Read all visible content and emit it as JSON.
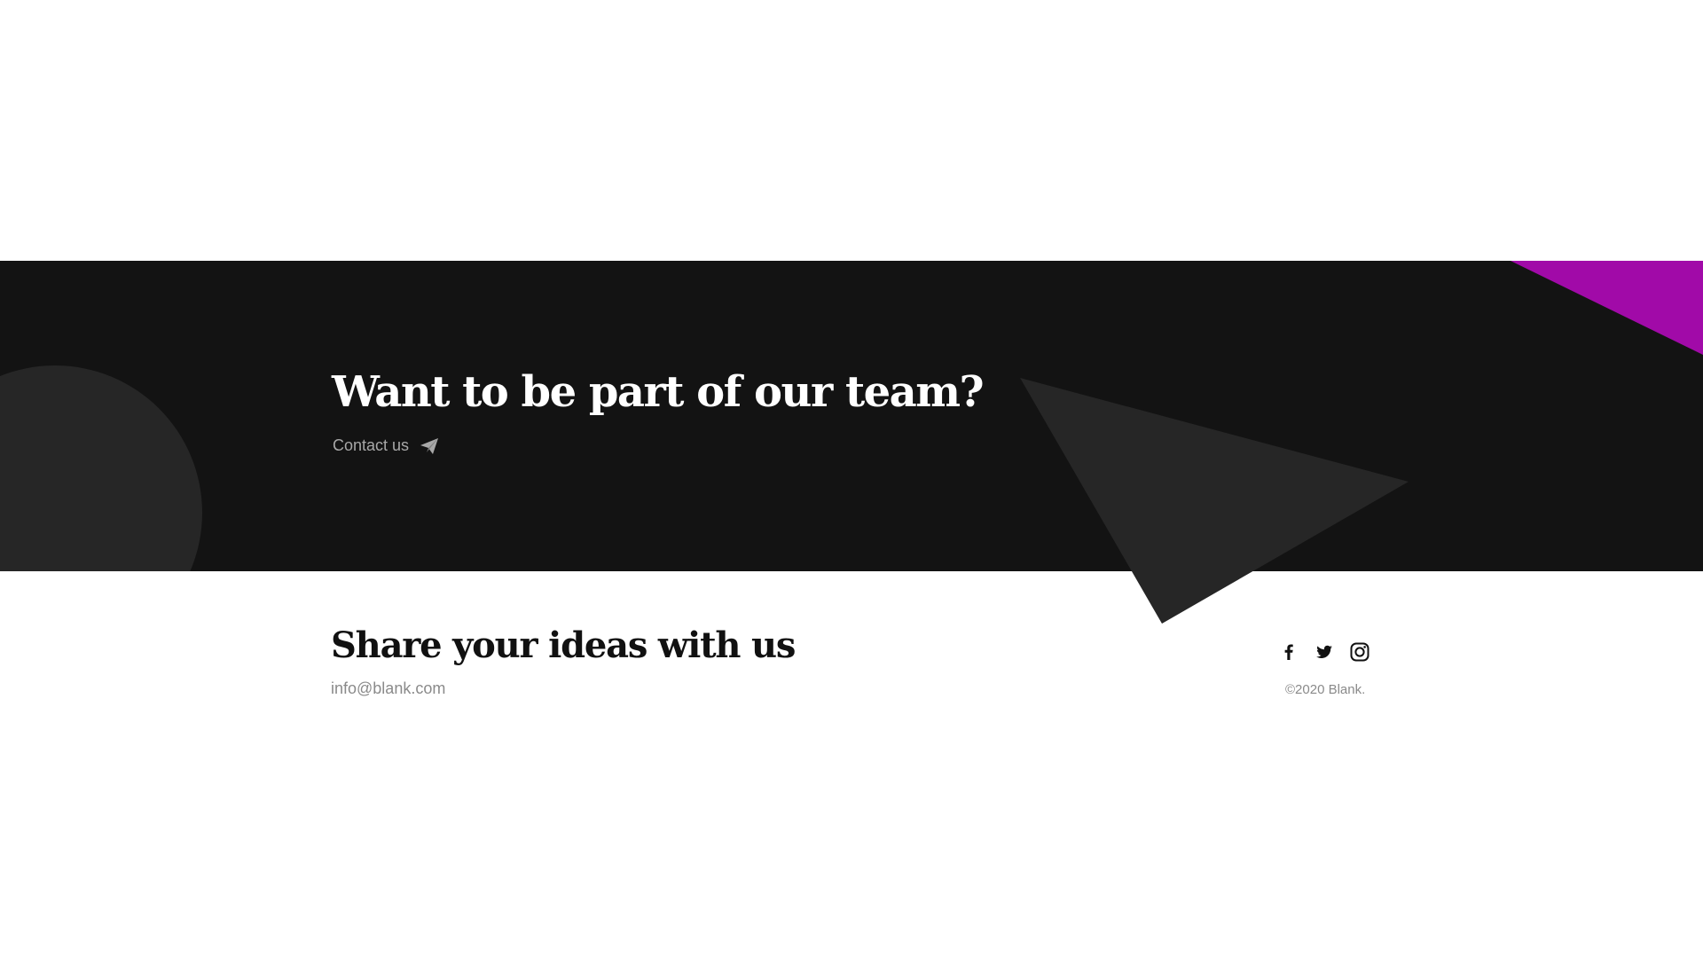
{
  "cta": {
    "title": "Want to be part of our team?",
    "link_label": "Contact us",
    "link_icon": "paper-plane-icon"
  },
  "footer": {
    "title": "Share your ideas with us",
    "email": "info@blank.com",
    "copyright": "©2020 Blank.",
    "social": [
      {
        "name": "Facebook",
        "icon": "facebook-icon"
      },
      {
        "name": "Twitter",
        "icon": "twitter-icon"
      },
      {
        "name": "Instagram",
        "icon": "instagram-icon"
      }
    ]
  },
  "colors": {
    "band_background": "#131313",
    "decoration_shape": "#262626",
    "accent": "#a10aa8",
    "heading_light": "#ffffff",
    "heading_dark": "#111111",
    "muted_text": "#8a8a8a"
  }
}
